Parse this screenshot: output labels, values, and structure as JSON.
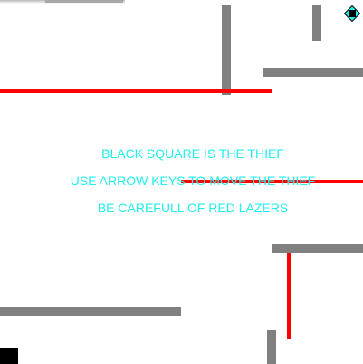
{
  "instructions": {
    "line1": "BLACK SQUARE IS THE THIEF",
    "line2": "USE ARROW KEYS TO MOVE THE THIEF",
    "line3": "BE CAREFULL OF RED LAZERS"
  },
  "colors": {
    "wall": "#808080",
    "laser": "#ff0000",
    "text": "#22eeee",
    "thief": "#000000",
    "goal_fill": "#22eeee",
    "goal_core": "#000000",
    "background": "#ffffff"
  },
  "icons": {
    "thief": "black-square",
    "goal": "diamond-target-icon"
  }
}
